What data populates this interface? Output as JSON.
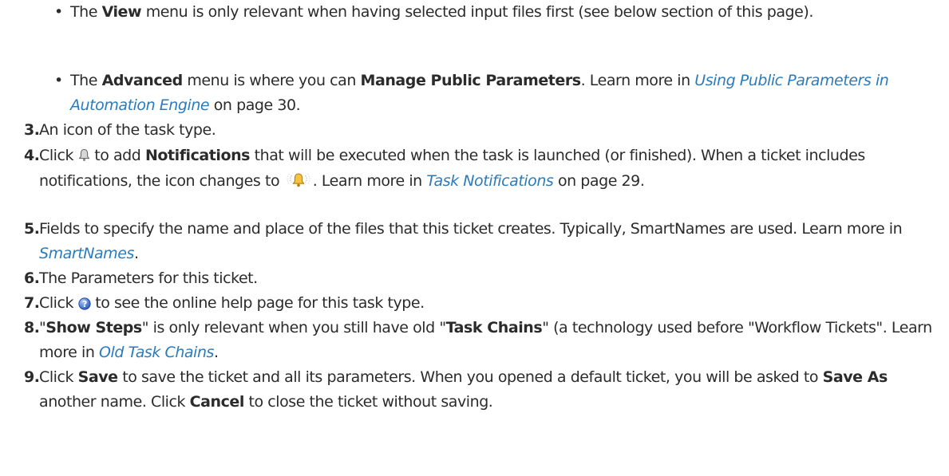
{
  "bullets": [
    {
      "t1": "The ",
      "b1": "View",
      "t2": " menu is only relevant when having selected input files first (see below section of this page)."
    },
    {
      "t1": "The ",
      "b1": "Advanced",
      "t2": " menu is where you can ",
      "b2": "Manage Public Parameters",
      "t3": ". Learn more in ",
      "link": "Using Public Parameters in Automation Engine",
      "t4": " on page 30."
    }
  ],
  "items": [
    {
      "num": "3.",
      "t1": "An icon of the task type."
    },
    {
      "num": "4.",
      "t1": "Click ",
      "t2": " to add ",
      "b1": "Notifications",
      "t3": " that will be executed when the task is launched (or finished). When a ticket includes notifications, the icon changes to ",
      "t4": ". Learn more in ",
      "link": "Task Notifications",
      "t5": " on page 29."
    },
    {
      "num": "5.",
      "t1": "Fields to specify the name and place of the files that this ticket creates. Typically, SmartNames are used. Learn more in ",
      "link": "SmartNames",
      "t2": "."
    },
    {
      "num": "6.",
      "t1": "The Parameters for this ticket."
    },
    {
      "num": "7.",
      "t1": "Click ",
      "t2": " to see the online help page for this task type."
    },
    {
      "num": "8.",
      "t1": "\"",
      "b1": "Show Steps",
      "t2": "\" is only relevant when you still have old \"",
      "b2": "Task Chains",
      "t3": "\" (a technology used before \"Workflow Tickets\". Learn more in ",
      "link": "Old Task Chains",
      "t4": "."
    },
    {
      "num": "9.",
      "t1": "Click ",
      "b1": "Save",
      "t2": " to save the ticket and all its parameters. When you opened a default ticket, you will be asked to ",
      "b2": "Save As",
      "t3": " another name. Click ",
      "b3": "Cancel",
      "t4": " to close the ticket without saving."
    }
  ]
}
